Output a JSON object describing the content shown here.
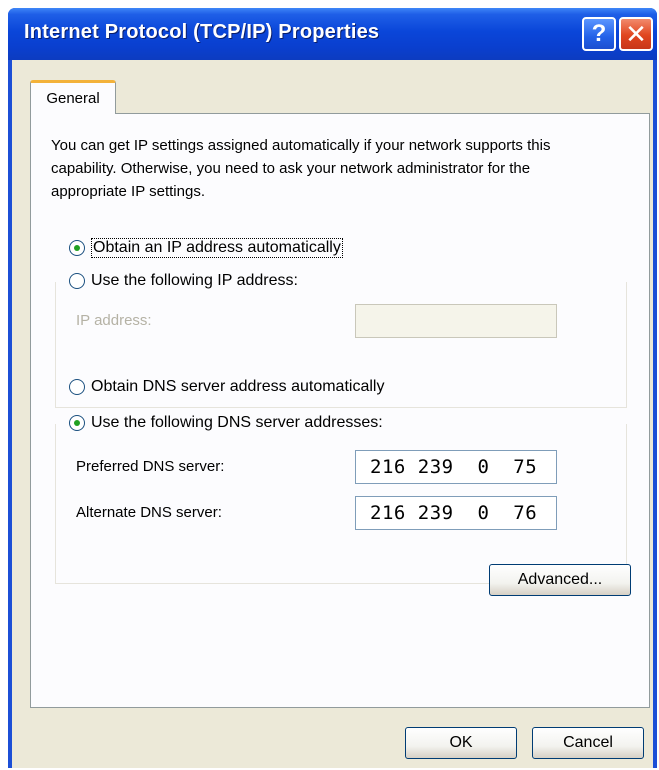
{
  "window": {
    "title": "Internet Protocol (TCP/IP) Properties",
    "help_label": "?",
    "close_label": "✕"
  },
  "tabs": [
    {
      "label": "General",
      "selected": true
    }
  ],
  "description": "You can get IP settings assigned automatically if your network supports this capability. Otherwise, you need to ask your network administrator for the appropriate IP settings.",
  "ip_mode": {
    "auto": {
      "label": "Obtain an IP address automatically",
      "checked": true
    },
    "manual": {
      "label": "Use the following IP address:",
      "checked": false
    }
  },
  "ip_address": {
    "label": "IP address:",
    "value": "",
    "enabled": false
  },
  "dns_mode": {
    "auto": {
      "label": "Obtain DNS server address automatically",
      "checked": false
    },
    "manual": {
      "label": "Use the following DNS server addresses:",
      "checked": true
    }
  },
  "dns": {
    "preferred": {
      "label": "Preferred DNS server:",
      "value": "216 239  0  75"
    },
    "alternate": {
      "label": "Alternate DNS server:",
      "value": "216 239  0  76"
    }
  },
  "buttons": {
    "advanced": "Advanced...",
    "ok": "OK",
    "cancel": "Cancel"
  },
  "colors": {
    "titlebar": "#0a46d9",
    "close_button": "#e0451e",
    "dialog_background": "#ece9d8",
    "tab_highlight": "#f3b23a"
  }
}
